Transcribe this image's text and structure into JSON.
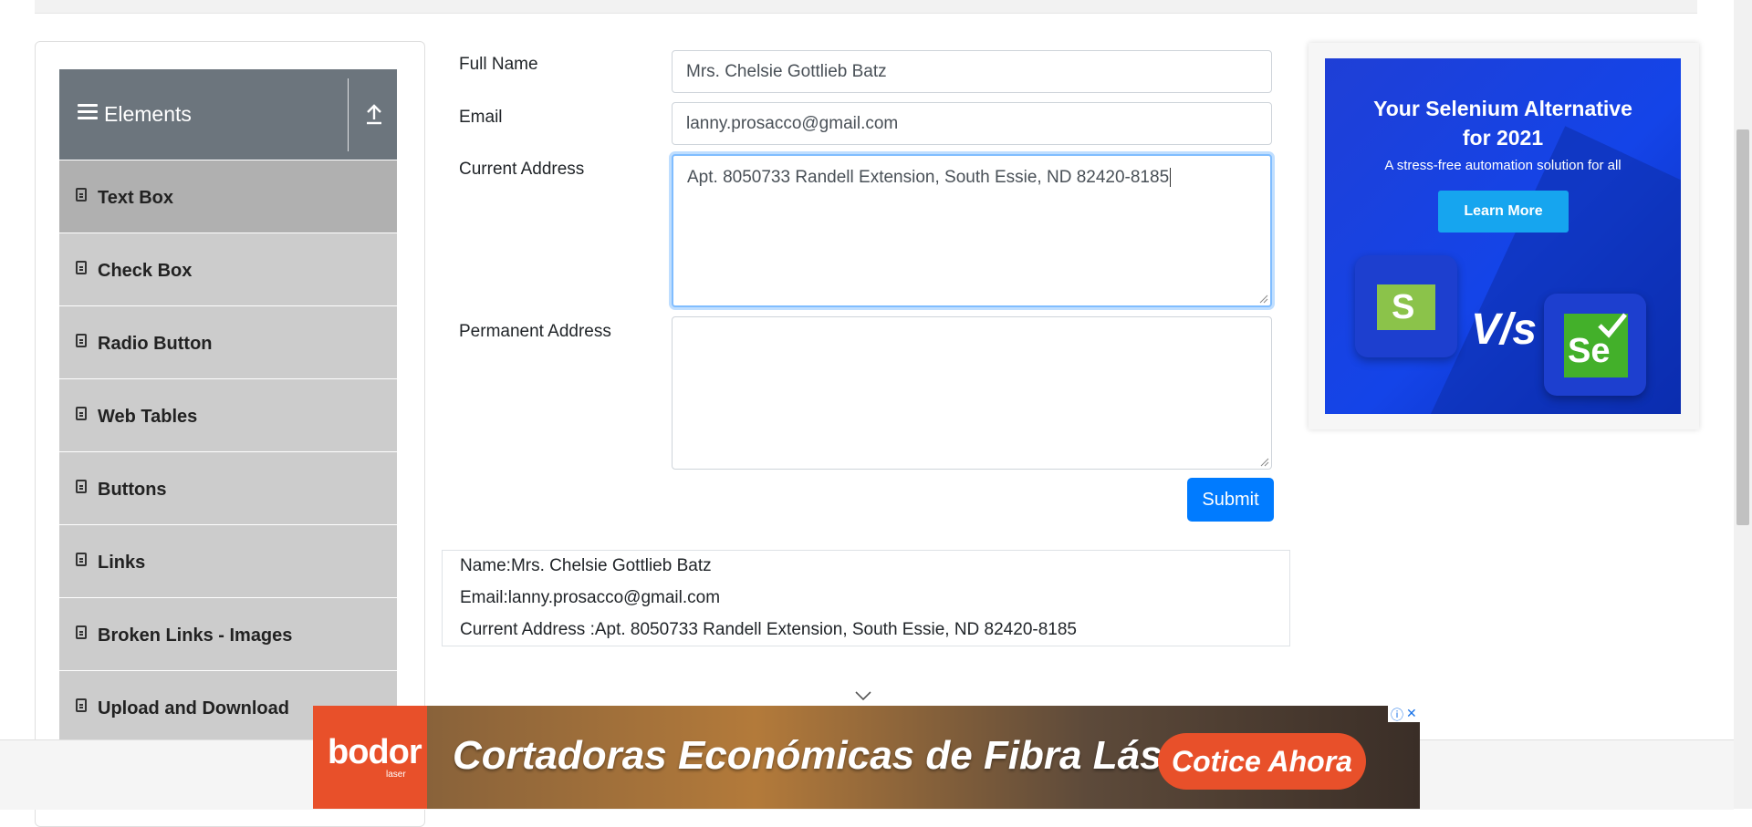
{
  "sidebar": {
    "group_title": "Elements",
    "items": [
      {
        "label": "Text Box"
      },
      {
        "label": "Check Box"
      },
      {
        "label": "Radio Button"
      },
      {
        "label": "Web Tables"
      },
      {
        "label": "Buttons"
      },
      {
        "label": "Links"
      },
      {
        "label": "Broken Links - Images"
      },
      {
        "label": "Upload and Download"
      }
    ]
  },
  "form": {
    "full_name_label": "Full Name",
    "full_name_value": "Mrs. Chelsie Gottlieb Batz",
    "email_label": "Email",
    "email_value": "lanny.prosacco@gmail.com",
    "current_address_label": "Current Address",
    "current_address_value": "Apt. 8050733 Randell Extension, South Essie, ND 82420-8185",
    "permanent_address_label": "Permanent Address",
    "permanent_address_value": "",
    "submit_label": "Submit"
  },
  "output": {
    "name": "Name:Mrs. Chelsie Gottlieb Batz",
    "email": "Email:lanny.prosacco@gmail.com",
    "current_address": "Current Address :Apt. 8050733 Randell Extension, South Essie, ND 82420-8185"
  },
  "ad_right": {
    "headline_line1": "Your Selenium Alternative",
    "headline_line2": "for 2021",
    "subtext": "A stress-free automation solution for all",
    "button": "Learn More",
    "vs": "V/s",
    "logo1_letter": "S",
    "logo2_letter": "Se"
  },
  "ad_bottom": {
    "brand": "bodor",
    "brand_sub": "laser",
    "headline": "Cortadoras Económicas de Fibra Láser",
    "cta": "Cotice Ahora"
  },
  "colors": {
    "accent": "#007bff",
    "sidebar_header": "#6c757d",
    "menu_item": "#cccccc",
    "menu_item_active": "#b0b0b0",
    "ad_orange": "#e8502a"
  }
}
